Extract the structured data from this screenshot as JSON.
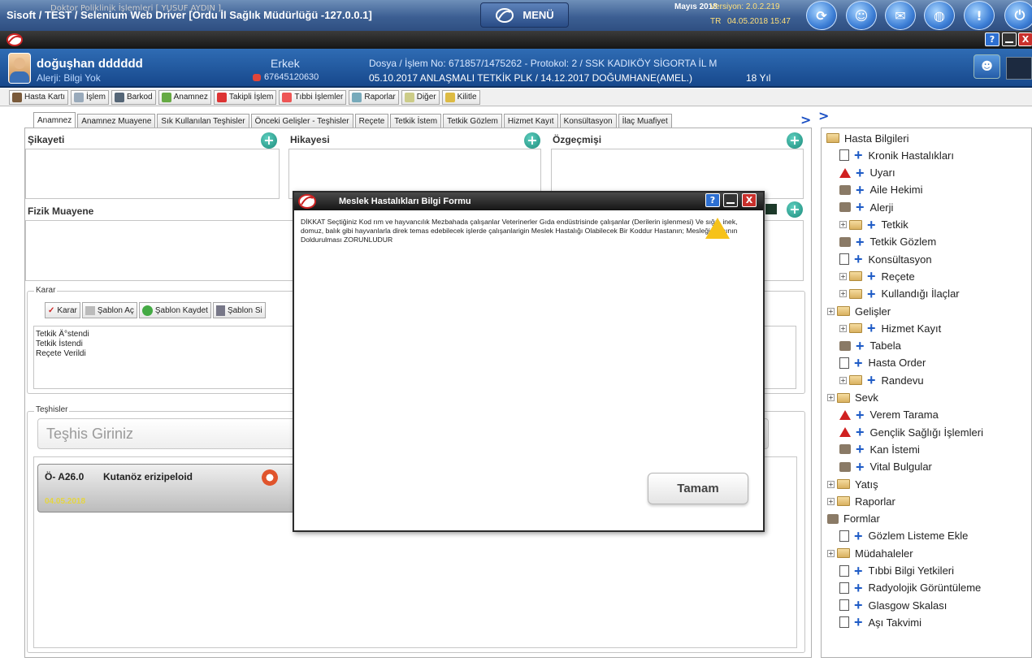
{
  "topbar": {
    "title": "Sisoft / TEST / Selenium Web Driver [Ordu İl Sağlık Müdürlüğü -127.0.0.1]",
    "menu_label": "MENÜ",
    "month": "Mayıs 2018",
    "version": "Versiyon: 2.0.2.219",
    "lang": "TR",
    "datetime": "04.05.2018 15:47",
    "icons": [
      "refresh-icon",
      "users-icon",
      "mail-icon",
      "globe-icon",
      "info-icon",
      "power-icon"
    ]
  },
  "window": {
    "title": "Doktor Poliklinik İşlemleri [ YUSUF AYDIN ]",
    "help_label": "?",
    "close_label": "X"
  },
  "patient": {
    "name": "doğuşhan dddddd",
    "allergy": "Alerji: Bilgi Yok",
    "gender": "Erkek",
    "phone": "67645120630",
    "dosya": "Dosya / İşlem No: 671857/1475262 - Protokol: 2 / SSK KADIKÖY SİGORTA İL M",
    "info": "05.10.2017 ANLAŞMALI TETKİK PLK / 14.12.2017 DOĞUMHANE(AMEL.)",
    "age": "18 Yıl"
  },
  "toolbar": {
    "items": [
      "Hasta Kartı",
      "İşlem",
      "Barkod",
      "Anamnez",
      "Takipli İşlem",
      "Tıbbi İşlemler",
      "Raporlar",
      "Diğer",
      "Kilitle"
    ]
  },
  "tabs": [
    "Anamnez",
    "Anamnez Muayene",
    "Sık Kullanılan Teşhisler",
    "Önceki Gelişler - Teşhisler",
    "Reçete",
    "Tetkik İstem",
    "Tetkik Gözlem",
    "Hizmet Kayıt",
    "Konsültasyon",
    "İlaç Muafiyet"
  ],
  "form": {
    "sikayeti": "Şikayeti",
    "hikayesi": "Hikayesi",
    "ozgecmisi": "Özgeçmişi",
    "fizik": "Fizik Muayene",
    "karar_legend": "Karar",
    "karar_buttons": [
      "Karar",
      "Şablon Aç",
      "Şablon Kaydet",
      "Şablon Si"
    ],
    "karar_lines": [
      "Tetkik Ä°stendi",
      "Tetkik İstendi",
      "Reçete Verildi"
    ],
    "teshisler_legend": "Teşhisler",
    "teshis_placeholder": "Teşhis Giriniz",
    "diagnosis": {
      "code": "Ö- A26.0",
      "name": "Kutanöz erizipeloid",
      "date": "04.05.2018"
    }
  },
  "tree": {
    "items": [
      {
        "label": "Hasta Bilgileri",
        "kind": "folder",
        "expand": "",
        "plus": false
      },
      {
        "label": "Kronik Hastalıkları",
        "kind": "doc",
        "expand": "",
        "plus": true
      },
      {
        "label": "Uyarı",
        "kind": "warn",
        "expand": "",
        "plus": true
      },
      {
        "label": "Aile Hekimi",
        "kind": "small",
        "expand": "",
        "plus": true
      },
      {
        "label": "Alerji",
        "kind": "small",
        "expand": "",
        "plus": true
      },
      {
        "label": "Tetkik",
        "kind": "folder",
        "expand": "+",
        "plus": true
      },
      {
        "label": "Tetkik Gözlem",
        "kind": "small",
        "expand": "",
        "plus": true
      },
      {
        "label": "Konsültasyon",
        "kind": "doc",
        "expand": "",
        "plus": true
      },
      {
        "label": "Reçete",
        "kind": "folder",
        "expand": "+",
        "plus": true
      },
      {
        "label": "Kullandığı İlaçlar",
        "kind": "folder",
        "expand": "+",
        "plus": true
      },
      {
        "label": "Gelişler",
        "kind": "folder",
        "expand": "+",
        "plus": false
      },
      {
        "label": "Hizmet Kayıt",
        "kind": "folder",
        "expand": "+",
        "plus": true
      },
      {
        "label": "Tabela",
        "kind": "small",
        "expand": "",
        "plus": true
      },
      {
        "label": "Hasta Order",
        "kind": "doc",
        "expand": "",
        "plus": true
      },
      {
        "label": "Randevu",
        "kind": "folder",
        "expand": "+",
        "plus": true
      },
      {
        "label": "Sevk",
        "kind": "folder",
        "expand": "+",
        "plus": false
      },
      {
        "label": "Verem Tarama",
        "kind": "warn",
        "expand": "",
        "plus": true
      },
      {
        "label": "Gençlik Sağlığı İşlemleri",
        "kind": "warn",
        "expand": "",
        "plus": true
      },
      {
        "label": "Kan İstemi",
        "kind": "small",
        "expand": "",
        "plus": true
      },
      {
        "label": "Vital Bulgular",
        "kind": "small",
        "expand": "",
        "plus": true
      },
      {
        "label": "Yatış",
        "kind": "folder",
        "expand": "+",
        "plus": false
      },
      {
        "label": "Raporlar",
        "kind": "folder",
        "expand": "+",
        "plus": false
      },
      {
        "label": "Formlar",
        "kind": "small",
        "expand": "",
        "plus": false
      },
      {
        "label": "Gözlem Listeme Ekle",
        "kind": "doc",
        "expand": "",
        "plus": true
      },
      {
        "label": "Müdahaleler",
        "kind": "folder",
        "expand": "+",
        "plus": false
      },
      {
        "label": "Tıbbi Bilgi Yetkileri",
        "kind": "doc",
        "expand": "",
        "plus": true
      },
      {
        "label": "Radyolojik Görüntüleme",
        "kind": "doc",
        "expand": "",
        "plus": true
      },
      {
        "label": "Glasgow Skalası",
        "kind": "doc",
        "expand": "",
        "plus": true
      },
      {
        "label": "Aşı Takvimi",
        "kind": "doc",
        "expand": "",
        "plus": true
      }
    ]
  },
  "modal": {
    "title": "Meslek Hastalıkları Bilgi Formu",
    "help_label": "?",
    "close_label": "X",
    "message": "DİKKAT Seçtiğiniz Kod rım ve hayvancılık Mezbahada çalışanlar Veterinerler Gıda endüstrisinde çalışanlar (Derilerin işlenmesi) Ve sığır, inek, domuz, balık gibi hayvanlarla direk temas edebilecek işlerde çalışanlarigin Meslek Hastalığı Olabilecek Bir Koddur Hastanın; Mesleği Alanının Doldurulması ZORUNLUDUR",
    "ok_label": "Tamam"
  },
  "colors": {
    "topbar": "#3c5f93",
    "patientbar": "#17488c",
    "accent_plus": "#1e5bc6",
    "teal_plus": "#1b8a7a"
  }
}
